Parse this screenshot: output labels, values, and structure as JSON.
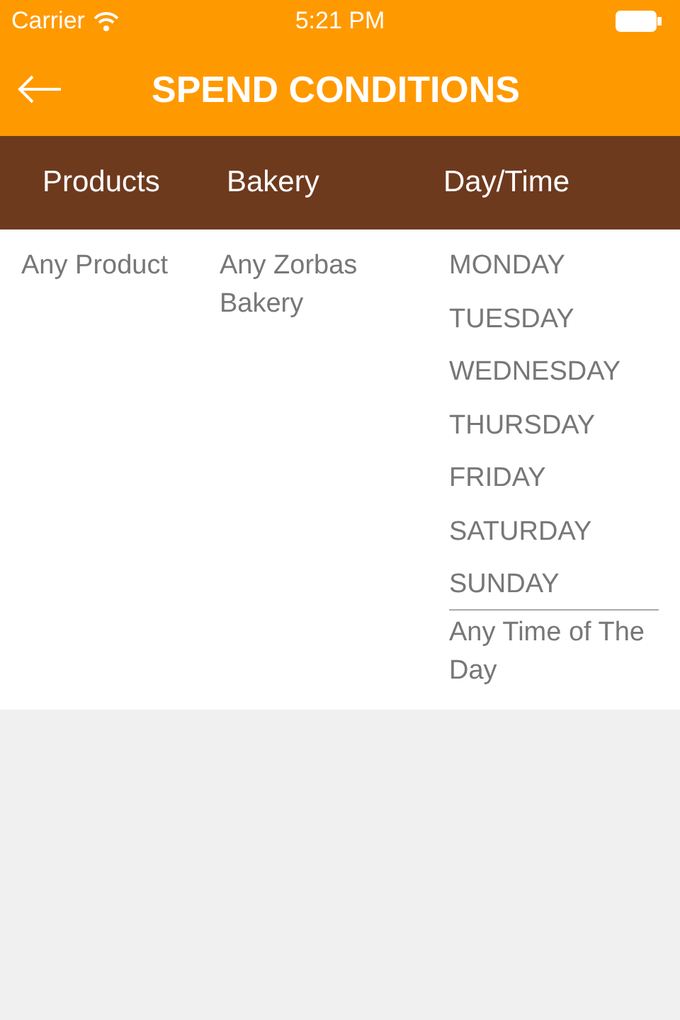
{
  "status_bar": {
    "carrier": "Carrier",
    "time": "5:21 PM"
  },
  "header": {
    "title": "SPEND CONDITIONS"
  },
  "table": {
    "columns": [
      "Products",
      "Bakery",
      "Day/Time"
    ],
    "row": {
      "product": "Any Product",
      "bakery": "Any Zorbas Bakery",
      "days": [
        "MONDAY",
        "TUESDAY",
        "WEDNESDAY",
        "THURSDAY",
        "FRIDAY",
        "SATURDAY",
        "SUNDAY"
      ],
      "time": "Any Time of The Day"
    }
  }
}
